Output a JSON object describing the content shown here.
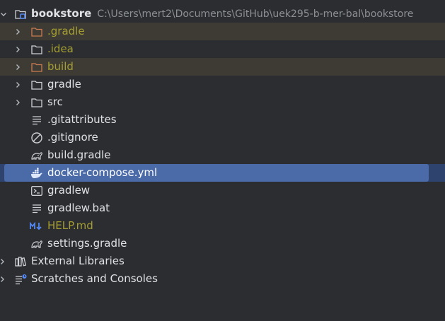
{
  "project": {
    "name": "bookstore",
    "path": "C:\\Users\\mert2\\Documents\\GitHub\\uek295-b-mer-bal\\bookstore"
  },
  "items": [
    {
      "label": ".gradle",
      "kind": "folder",
      "expandable": true,
      "status": "excluded"
    },
    {
      "label": ".idea",
      "kind": "folder",
      "expandable": true,
      "status": "ignored"
    },
    {
      "label": "build",
      "kind": "folder",
      "expandable": true,
      "status": "excluded"
    },
    {
      "label": "gradle",
      "kind": "folder",
      "expandable": true,
      "status": "normal"
    },
    {
      "label": "src",
      "kind": "folder",
      "expandable": true,
      "status": "normal"
    },
    {
      "label": ".gitattributes",
      "kind": "text-file",
      "status": "normal"
    },
    {
      "label": ".gitignore",
      "kind": "ignore-file",
      "status": "normal"
    },
    {
      "label": "build.gradle",
      "kind": "gradle-file",
      "status": "normal"
    },
    {
      "label": "docker-compose.yml",
      "kind": "docker-file",
      "status": "selected"
    },
    {
      "label": "gradlew",
      "kind": "shell-file",
      "status": "normal"
    },
    {
      "label": "gradlew.bat",
      "kind": "text-file",
      "status": "normal"
    },
    {
      "label": "HELP.md",
      "kind": "markdown-file",
      "status": "ignored"
    },
    {
      "label": "settings.gradle",
      "kind": "gradle-file",
      "status": "normal"
    }
  ],
  "external_libraries": {
    "label": "External Libraries"
  },
  "scratches": {
    "label": "Scratches and Consoles"
  },
  "colors": {
    "background": "#2b2d30",
    "selection": "#4a6aa8",
    "excluded_row": "#3d3b34",
    "excluded_folder": "#c97b52",
    "ignored_text": "#a59e32"
  }
}
